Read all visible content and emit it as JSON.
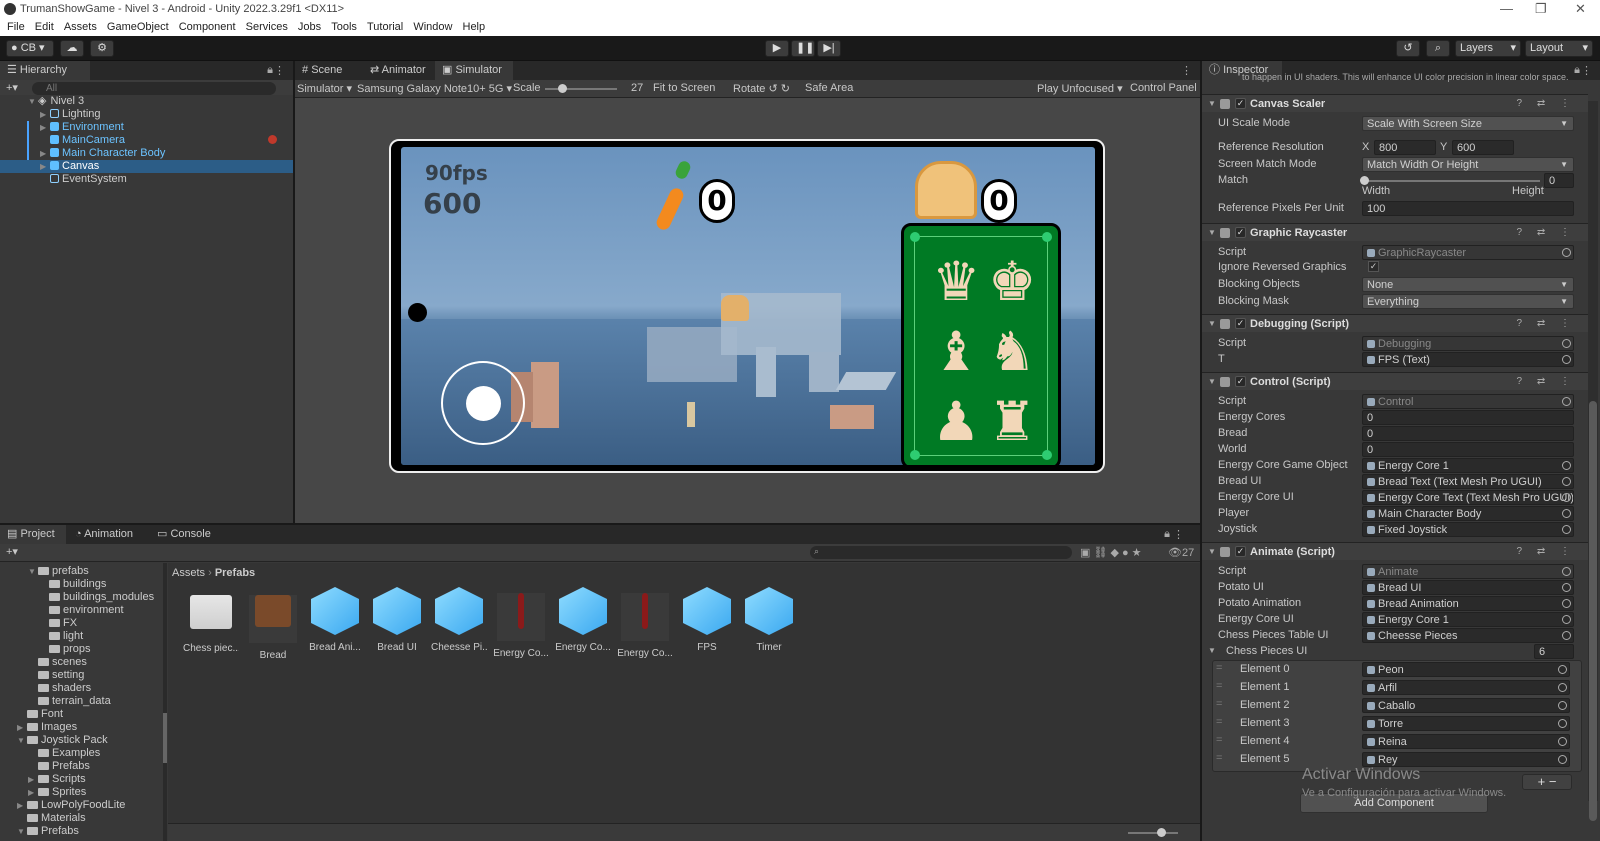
{
  "window": {
    "title": "TrumanShowGame - Nivel 3 - Android - Unity 2022.3.29f1 <DX11>"
  },
  "menu": [
    "File",
    "Edit",
    "Assets",
    "GameObject",
    "Component",
    "Services",
    "Jobs",
    "Tools",
    "Tutorial",
    "Window",
    "Help"
  ],
  "toolbar": {
    "account": "CB",
    "layers": "Layers",
    "layout": "Layout"
  },
  "hierarchy": {
    "tab": "Hierarchy",
    "search_placeholder": "All",
    "scene": "Nivel 3",
    "items": [
      "Lighting",
      "Environment",
      "MainCamera",
      "Main Character Body",
      "Canvas",
      "EventSystem"
    ]
  },
  "center_tabs": [
    "Scene",
    "Animator",
    "Simulator"
  ],
  "simulator": {
    "mode": "Simulator",
    "device": "Samsung Galaxy Note10+ 5G",
    "scale_label": "Scale",
    "scale_value": "27",
    "fit": "Fit to Screen",
    "rotate": "Rotate",
    "safe_area": "Safe Area",
    "play_mode": "Play Unfocused",
    "control_panel": "Control Panel",
    "game": {
      "fps": "90fps",
      "fps_value": "600",
      "carrot_count": "0",
      "bread_count": "0"
    }
  },
  "bottom_tabs": [
    "Project",
    "Animation",
    "Console"
  ],
  "project": {
    "count": "27",
    "breadcrumb": [
      "Assets",
      "Prefabs"
    ],
    "tree": [
      {
        "label": "prefabs",
        "indent": 2,
        "arrow": "▼"
      },
      {
        "label": "buildings",
        "indent": 3,
        "arrow": ""
      },
      {
        "label": "buildings_modules",
        "indent": 3,
        "arrow": ""
      },
      {
        "label": "environment",
        "indent": 3,
        "arrow": ""
      },
      {
        "label": "FX",
        "indent": 3,
        "arrow": ""
      },
      {
        "label": "light",
        "indent": 3,
        "arrow": ""
      },
      {
        "label": "props",
        "indent": 3,
        "arrow": ""
      },
      {
        "label": "scenes",
        "indent": 2,
        "arrow": ""
      },
      {
        "label": "setting",
        "indent": 2,
        "arrow": ""
      },
      {
        "label": "shaders",
        "indent": 2,
        "arrow": ""
      },
      {
        "label": "terrain_data",
        "indent": 2,
        "arrow": ""
      },
      {
        "label": "Font",
        "indent": 1,
        "arrow": ""
      },
      {
        "label": "Images",
        "indent": 1,
        "arrow": "▶"
      },
      {
        "label": "Joystick Pack",
        "indent": 1,
        "arrow": "▼"
      },
      {
        "label": "Examples",
        "indent": 2,
        "arrow": ""
      },
      {
        "label": "Prefabs",
        "indent": 2,
        "arrow": ""
      },
      {
        "label": "Scripts",
        "indent": 2,
        "arrow": "▶"
      },
      {
        "label": "Sprites",
        "indent": 2,
        "arrow": "▶"
      },
      {
        "label": "LowPolyFoodLite",
        "indent": 1,
        "arrow": "▶"
      },
      {
        "label": "Materials",
        "indent": 1,
        "arrow": ""
      },
      {
        "label": "Prefabs",
        "indent": 1,
        "arrow": "▼"
      }
    ],
    "assets": [
      {
        "label": "Chess piec...",
        "kind": "folder"
      },
      {
        "label": "Bread",
        "kind": "bread"
      },
      {
        "label": "Bread Ani...",
        "kind": "cube"
      },
      {
        "label": "Bread UI",
        "kind": "cube"
      },
      {
        "label": "Cheesse Pi...",
        "kind": "cube"
      },
      {
        "label": "Energy Co...",
        "kind": "carrot"
      },
      {
        "label": "Energy Co...",
        "kind": "cube"
      },
      {
        "label": "Energy Co...",
        "kind": "carrot"
      },
      {
        "label": "FPS",
        "kind": "cube"
      },
      {
        "label": "Timer",
        "kind": "cube"
      }
    ]
  },
  "inspector": {
    "tab": "Inspector",
    "top_text": "to happen in UI shaders. This will enhance UI color precision in linear color space.",
    "canvas_scaler": {
      "title": "Canvas Scaler",
      "ui_scale_mode_label": "UI Scale Mode",
      "ui_scale_mode": "Scale With Screen Size",
      "ref_res_label": "Reference Resolution",
      "ref_x_label": "X",
      "ref_x": "800",
      "ref_y_label": "Y",
      "ref_y": "600",
      "match_mode_label": "Screen Match Mode",
      "match_mode": "Match Width Or Height",
      "match_label": "Match",
      "match_value": "0",
      "width_label": "Width",
      "height_label": "Height",
      "ppu_label": "Reference Pixels Per Unit",
      "ppu": "100"
    },
    "graphic_raycaster": {
      "title": "Graphic Raycaster",
      "script_label": "Script",
      "script": "GraphicRaycaster",
      "ignore_label": "Ignore Reversed Graphics",
      "ignore": "✓",
      "blocking_objects_label": "Blocking Objects",
      "blocking_objects": "None",
      "blocking_mask_label": "Blocking Mask",
      "blocking_mask": "Everything"
    },
    "debugging": {
      "title": "Debugging (Script)",
      "script_label": "Script",
      "script": "Debugging",
      "t_label": "T",
      "t": "FPS (Text)"
    },
    "control": {
      "title": "Control (Script)",
      "fields": [
        {
          "label": "Script",
          "value": "Control"
        },
        {
          "label": "Energy Cores",
          "value": "0"
        },
        {
          "label": "Bread",
          "value": "0"
        },
        {
          "label": "World",
          "value": "0"
        },
        {
          "label": "Energy Core Game Object",
          "value": "Energy Core 1"
        },
        {
          "label": "Bread UI",
          "value": "Bread Text (Text Mesh Pro UGUI)"
        },
        {
          "label": "Energy Core UI",
          "value": "Energy Core Text (Text Mesh Pro UGUI)"
        },
        {
          "label": "Player",
          "value": "Main Character Body"
        },
        {
          "label": "Joystick",
          "value": "Fixed Joystick"
        }
      ]
    },
    "animate": {
      "title": "Animate (Script)",
      "fields": [
        {
          "label": "Script",
          "value": "Animate"
        },
        {
          "label": "Potato UI",
          "value": "Bread UI"
        },
        {
          "label": "Potato Animation",
          "value": "Bread Animation"
        },
        {
          "label": "Energy Core UI",
          "value": "Energy Core 1"
        },
        {
          "label": "Chess Pieces Table UI",
          "value": "Cheesse Pieces"
        }
      ],
      "list_label": "Chess Pieces UI",
      "list_count": "6",
      "elements": [
        {
          "label": "Element 0",
          "value": "Peon"
        },
        {
          "label": "Element 1",
          "value": "Arfil"
        },
        {
          "label": "Element 2",
          "value": "Caballo"
        },
        {
          "label": "Element 3",
          "value": "Torre"
        },
        {
          "label": "Element 4",
          "value": "Reina"
        },
        {
          "label": "Element 5",
          "value": "Rey"
        }
      ]
    },
    "add_component": "Add Component",
    "watermark_title": "Activar Windows",
    "watermark_sub": "Ve a Configuración para activar Windows."
  }
}
